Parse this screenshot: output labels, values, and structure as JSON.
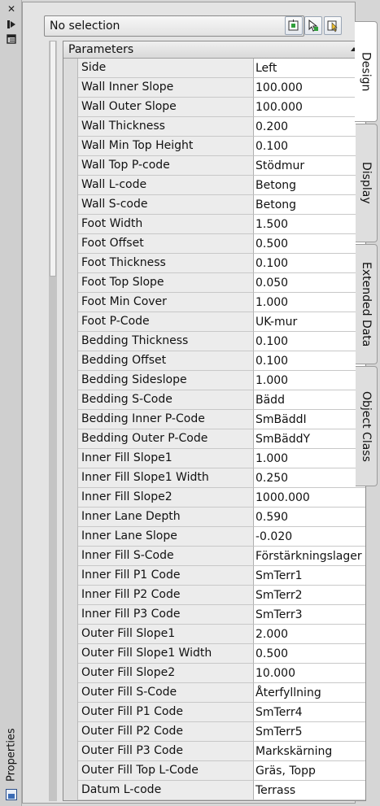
{
  "panel": {
    "title": "Properties"
  },
  "selection": {
    "value": "No selection"
  },
  "toolbar": {
    "buttons": [
      "pickadd-icon",
      "select-objects-icon",
      "quick-select-icon"
    ]
  },
  "grid": {
    "section_title": "Parameters",
    "rows": [
      {
        "name": "Side",
        "value": "Left"
      },
      {
        "name": "Wall Inner Slope",
        "value": "100.000"
      },
      {
        "name": "Wall Outer Slope",
        "value": "100.000"
      },
      {
        "name": "Wall Thickness",
        "value": "0.200"
      },
      {
        "name": "Wall Min Top Height",
        "value": "0.100"
      },
      {
        "name": "Wall Top P-code",
        "value": "Stödmur"
      },
      {
        "name": "Wall L-code",
        "value": "Betong"
      },
      {
        "name": "Wall S-code",
        "value": "Betong"
      },
      {
        "name": "Foot Width",
        "value": "1.500"
      },
      {
        "name": "Foot Offset",
        "value": "0.500"
      },
      {
        "name": "Foot Thickness",
        "value": "0.100"
      },
      {
        "name": "Foot Top Slope",
        "value": "0.050"
      },
      {
        "name": "Foot Min Cover",
        "value": "1.000"
      },
      {
        "name": "Foot P-Code",
        "value": "UK-mur"
      },
      {
        "name": "Bedding Thickness",
        "value": "0.100"
      },
      {
        "name": "Bedding Offset",
        "value": "0.100"
      },
      {
        "name": "Bedding Sideslope",
        "value": "1.000"
      },
      {
        "name": "Bedding S-Code",
        "value": "Bädd"
      },
      {
        "name": "Bedding Inner P-Code",
        "value": "SmBäddI"
      },
      {
        "name": "Bedding Outer P-Code",
        "value": "SmBäddY"
      },
      {
        "name": "Inner Fill Slope1",
        "value": "1.000"
      },
      {
        "name": "Inner Fill Slope1 Width",
        "value": "0.250"
      },
      {
        "name": "Inner Fill Slope2",
        "value": "1000.000"
      },
      {
        "name": "Inner Lane Depth",
        "value": "0.590"
      },
      {
        "name": "Inner Lane Slope",
        "value": "-0.020"
      },
      {
        "name": "Inner Fill S-Code",
        "value": "Förstärkningslager"
      },
      {
        "name": "Inner Fill P1 Code",
        "value": "SmTerr1"
      },
      {
        "name": "Inner Fill P2 Code",
        "value": "SmTerr2"
      },
      {
        "name": "Inner Fill P3 Code",
        "value": "SmTerr3"
      },
      {
        "name": "Outer Fill Slope1",
        "value": "2.000"
      },
      {
        "name": "Outer Fill Slope1 Width",
        "value": "0.500"
      },
      {
        "name": "Outer Fill Slope2",
        "value": "10.000"
      },
      {
        "name": "Outer Fill S-Code",
        "value": "Återfyllning"
      },
      {
        "name": "Outer Fill P1 Code",
        "value": "SmTerr4"
      },
      {
        "name": "Outer Fill P2 Code",
        "value": "SmTerr5"
      },
      {
        "name": "Outer Fill P3 Code",
        "value": "Markskärning"
      },
      {
        "name": "Outer Fill Top L-Code",
        "value": "Gräs, Topp"
      },
      {
        "name": "Datum L-code",
        "value": "Terrass"
      }
    ]
  },
  "tabs": [
    {
      "label": "Design",
      "active": true
    },
    {
      "label": "Display",
      "active": false
    },
    {
      "label": "Extended Data",
      "active": false
    },
    {
      "label": "Object Class",
      "active": false
    }
  ]
}
